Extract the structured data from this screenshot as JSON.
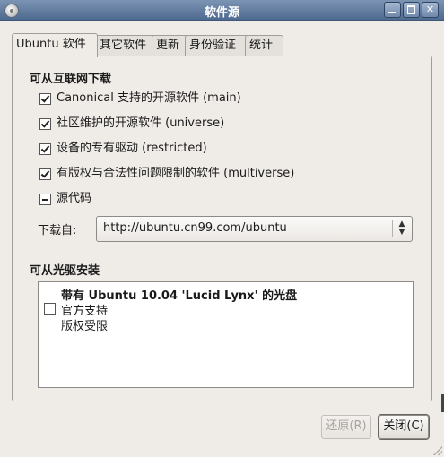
{
  "window": {
    "title": "软件源",
    "controls": {
      "minimize": "minimize",
      "maximize": "maximize",
      "close": "✕"
    }
  },
  "tabs": [
    {
      "label": "Ubuntu 软件",
      "active": true
    },
    {
      "label": "其它软件",
      "active": false
    },
    {
      "label": "更新",
      "active": false
    },
    {
      "label": "身份验证",
      "active": false
    },
    {
      "label": "统计",
      "active": false
    }
  ],
  "internet_section": {
    "title": "可从互联网下载",
    "items": [
      {
        "label": "Canonical 支持的开源软件 (main)",
        "state": "checked"
      },
      {
        "label": "社区维护的开源软件 (universe)",
        "state": "checked"
      },
      {
        "label": "设备的专有驱动 (restricted)",
        "state": "checked"
      },
      {
        "label": "有版权与合法性问题限制的软件 (multiverse)",
        "state": "checked"
      },
      {
        "label": "源代码",
        "state": "mixed"
      }
    ],
    "download_from_label": "下载自:",
    "download_from_value": "http://ubuntu.cn99.com/ubuntu"
  },
  "cdrom_section": {
    "title": "可从光驱安装",
    "entry": {
      "title": "带有 Ubuntu 10.04 'Lucid Lynx' 的光盘",
      "line1": "官方支持",
      "line2": "版权受限",
      "checked": false
    }
  },
  "buttons": {
    "revert": "还原(R)",
    "close": "关闭(C)"
  },
  "colors": {
    "titlebar": "#5f7aa0",
    "window_bg": "#efebe7"
  }
}
